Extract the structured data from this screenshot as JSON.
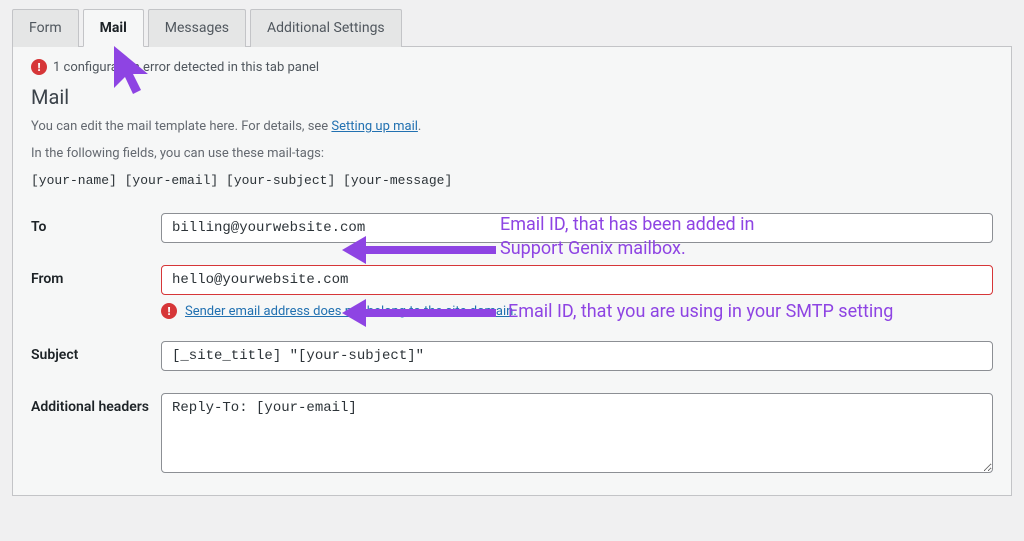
{
  "tabs": {
    "form": "Form",
    "mail": "Mail",
    "messages": "Messages",
    "additional": "Additional Settings"
  },
  "alert": {
    "text": "1 configuration error detected in this tab panel"
  },
  "section": {
    "title": "Mail",
    "desc1_prefix": "You can edit the mail template here. For details, see ",
    "desc1_link": "Setting up mail",
    "desc1_suffix": ".",
    "desc2": "In the following fields, you can use these mail-tags:",
    "mailtags": "[your-name] [your-email] [your-subject] [your-message]"
  },
  "fields": {
    "to_label": "To",
    "to_value": "billing@yourwebsite.com",
    "from_label": "From",
    "from_value": "hello@yourwebsite.com",
    "from_error": "Sender email address does not belong to the site domain.",
    "subject_label": "Subject",
    "subject_value": "[_site_title] \"[your-subject]\"",
    "headers_label": "Additional headers",
    "headers_value": "Reply-To: [your-email]"
  },
  "annotations": {
    "to_note": "Email ID, that has been added in\nSupport Genix mailbox.",
    "from_note": "Email ID, that you are using in your SMTP setting"
  },
  "colors": {
    "accent_purple": "#8e44e3",
    "error_red": "#d63638",
    "link_blue": "#2271b1"
  }
}
